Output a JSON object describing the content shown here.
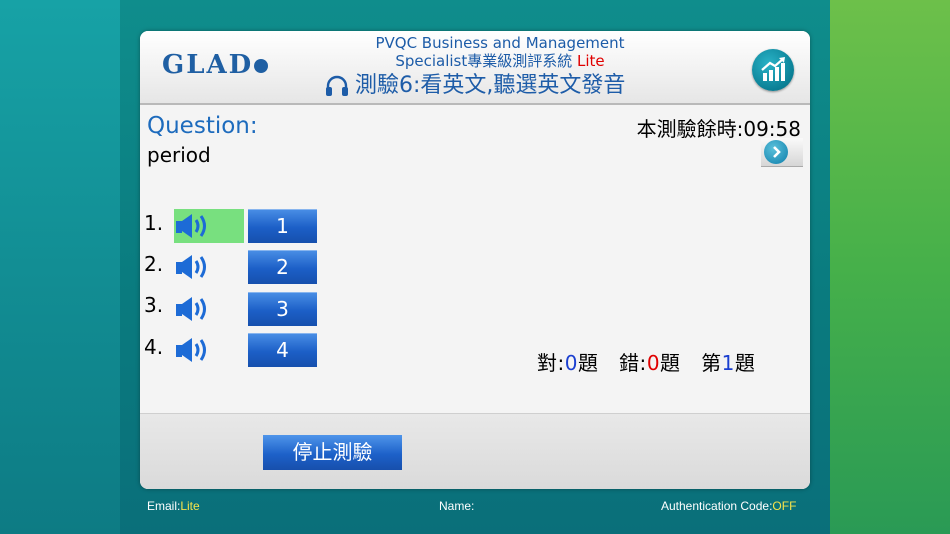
{
  "header": {
    "logo_text": "GLAD",
    "title_line1": "PVQC Business and Management",
    "title_line2": "Specialist專業級測評系統",
    "title_line2_badge": "Lite",
    "test_title": "測驗6:看英文,聽選英文發音",
    "headphones_icon": "headphones-icon",
    "stats_icon": "chart-up-icon"
  },
  "question": {
    "label": "Question:",
    "word": "period",
    "timer": "本測驗餘時:09:58"
  },
  "options": [
    {
      "number": "1.",
      "answer": "1",
      "active": true
    },
    {
      "number": "2.",
      "answer": "2",
      "active": false
    },
    {
      "number": "3.",
      "answer": "3",
      "active": false
    },
    {
      "number": "4.",
      "answer": "4",
      "active": false
    }
  ],
  "score": {
    "correct_label": "對:",
    "correct": "0",
    "correct_unit": "題",
    "wrong_label": "錯:",
    "wrong": "0",
    "wrong_unit": "題",
    "question_label": "第",
    "question_no": "1",
    "question_unit": "題"
  },
  "stop_button": "停止測驗",
  "footer": {
    "email_label": "Email:",
    "email_value": "Lite",
    "name_label": "Name:",
    "auth_label": "Authentication Code:",
    "auth_value": "OFF"
  },
  "colors": {
    "accent_blue": "#1d5ca8",
    "active_green": "#78e07f",
    "button_blue": "#1c5fc7",
    "badge_red": "#e00000",
    "footer_yellow": "#f7e34a"
  }
}
